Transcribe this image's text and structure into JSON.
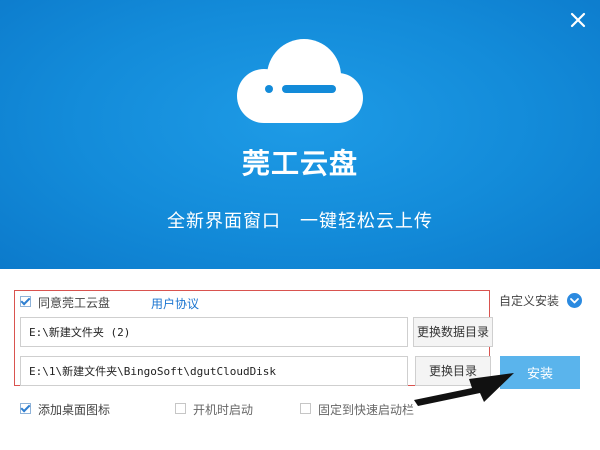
{
  "window": {
    "close_glyph": "✕"
  },
  "hero": {
    "logo_icon": "cloud-icon",
    "app_title": "莞工云盘",
    "slogan": "全新界面窗口　一键轻松云上传",
    "colors": {
      "top": "#1e9be6",
      "bottom": "#0c7acb"
    }
  },
  "agreement": {
    "checked": true,
    "label": "同意莞工云盘",
    "link": "用户协议"
  },
  "custom_install": {
    "label": "自定义安装",
    "icon": "chevron-down-icon"
  },
  "data_dir": {
    "value": "E:\\新建文件夹 (2)",
    "button": "更换数据目录"
  },
  "install_dir": {
    "value": "E:\\1\\新建文件夹\\BingoSoft\\dgutCloudDisk",
    "button": "更换目录"
  },
  "install_button": {
    "label": "安装",
    "color": "#5ab4ec"
  },
  "options": [
    {
      "label": "添加桌面图标",
      "checked": true
    },
    {
      "label": "开机时启动",
      "checked": false
    },
    {
      "label": "固定到快速启动栏",
      "checked": false
    }
  ],
  "annotation": {
    "highlight_color": "#d9534f",
    "arrow_icon": "arrow-icon"
  }
}
